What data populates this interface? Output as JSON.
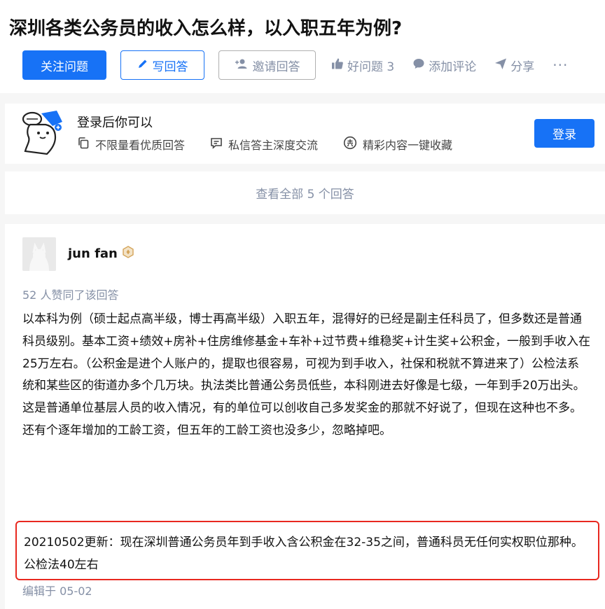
{
  "question": {
    "title": "深圳各类公务员的收入怎么样，以入职五年为例?",
    "follow_label": "关注问题",
    "write_answer_label": "写回答",
    "invite_label": "邀请回答",
    "good_question_label": "好问题 3",
    "comment_label": "添加评论",
    "share_label": "分享",
    "more_label": "···"
  },
  "login_card": {
    "title": "登录后你可以",
    "features": [
      "不限量看优质回答",
      "私信答主深度交流",
      "精彩内容一键收藏"
    ],
    "login_button": "登录"
  },
  "view_all": "查看全部 5 个回答",
  "answer": {
    "author": "jun fan",
    "likes_text": "52 人赞同了该回答",
    "body": "以本科为例（硕士起点高半级，博士再高半级）入职五年，混得好的已经是副主任科员了，但多数还是普通科员级别。基本工资+绩效+房补+住房维修基金+车补+过节费+维稳奖+计生奖+公积金，一般到手收入在25万左右。（公积金是进个人账户的，提取也很容易，可视为到手收入，社保和税就不算进来了）公检法系统和某些区的街道办多个几万块。执法类比普通公务员低些，本科刚进去好像是七级，一年到手20万出头。这是普通单位基层人员的收入情况，有的单位可以创收自己多发奖金的那就不好说了，但现在这种也不多。还有个逐年增加的工龄工资，但五年的工龄工资也没多少，忽略掉吧。",
    "update_text": "20210502更新：现在深圳普通公务员年到手收入含公积金在32-35之间，普通科员无任何实权职位那种。公检法40左右",
    "edited": "编辑于 05-02"
  },
  "colors": {
    "brand_blue": "#1772f6",
    "muted": "#8590a6",
    "highlight_border": "#e8281f"
  }
}
